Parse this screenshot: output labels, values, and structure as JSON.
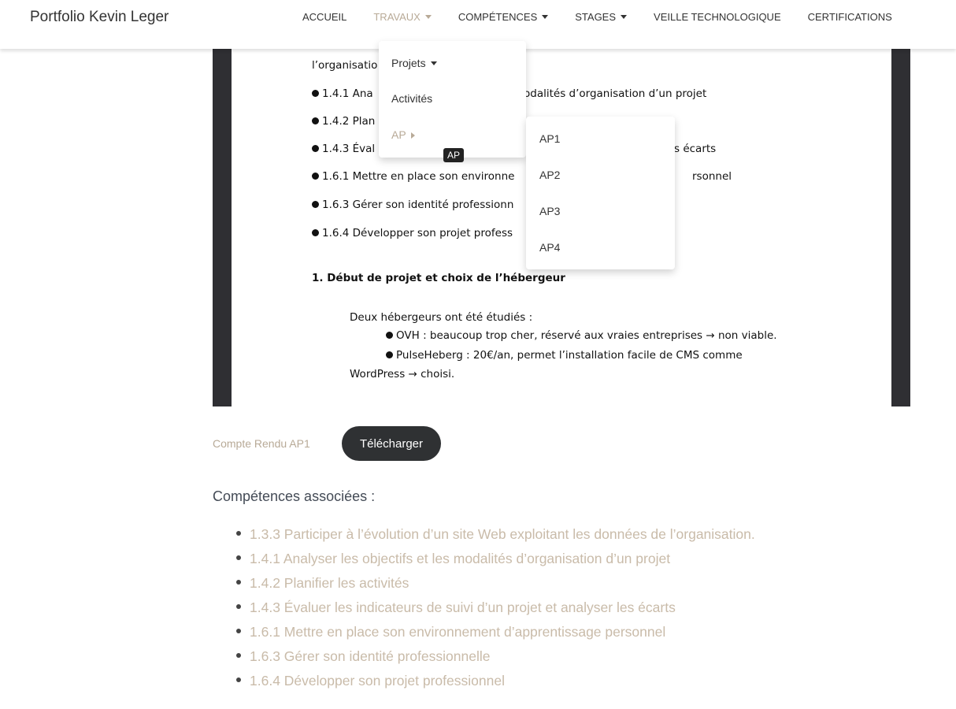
{
  "navbar": {
    "brand": "Portfolio Kevin Leger",
    "items": [
      {
        "label": "ACCUEIL",
        "active": false,
        "caret": false
      },
      {
        "label": "TRAVAUX",
        "active": true,
        "caret": true
      },
      {
        "label": "COMPÉTENCES",
        "active": false,
        "caret": true
      },
      {
        "label": "STAGES",
        "active": false,
        "caret": true
      },
      {
        "label": "VEILLE TECHNOLOGIQUE",
        "active": false,
        "caret": false
      },
      {
        "label": "CERTIFICATIONS",
        "active": false,
        "caret": false
      }
    ]
  },
  "dropdown": {
    "items": [
      "Projets",
      "Activités",
      "AP"
    ],
    "tooltip": "AP",
    "submenu": [
      "AP1",
      "AP2",
      "AP3",
      "AP4"
    ]
  },
  "document": {
    "lines": [
      "l’organisatio",
      "1.4.1 Ana",
      "odalités d’organisation d’un projet",
      "1.4.2 Plan",
      "1.4.3 Éval",
      "s écarts",
      "1.6.1 Mettre en place son environne",
      "rsonnel",
      "1.6.3 Gérer son identité professionn",
      "1.6.4 Développer son projet profess",
      "1. Début de projet et choix de l’hébergeur",
      "Deux hébergeurs ont été étudiés :",
      "OVH : beaucoup trop cher, réservé aux vraies entreprises → non viable.",
      "PulseHeberg : 20€/an, permet l’installation facile de CMS comme",
      "WordPress → choisi."
    ]
  },
  "report": {
    "label": "Compte Rendu AP1",
    "download_label": "Télécharger"
  },
  "skills": {
    "title": "Compétences associées :",
    "items": [
      "1.3.3 Participer à l’évolution d’un site Web exploitant les données de l’organisation.",
      "1.4.1 Analyser les objectifs et les modalités d’organisation d’un projet",
      "1.4.2 Planifier les activités",
      "1.4.3 Évaluer les indicateurs de suivi d’un projet et analyser les écarts",
      "1.6.1 Mettre en place son environnement d’apprentissage personnel",
      "1.6.3 Gérer son identité professionnelle",
      "1.6.4 Développer son projet professionnel"
    ]
  },
  "colors": {
    "accent": "#b8aa97",
    "viewer_frame": "#2f2f33",
    "button_bg": "#2f3133"
  }
}
